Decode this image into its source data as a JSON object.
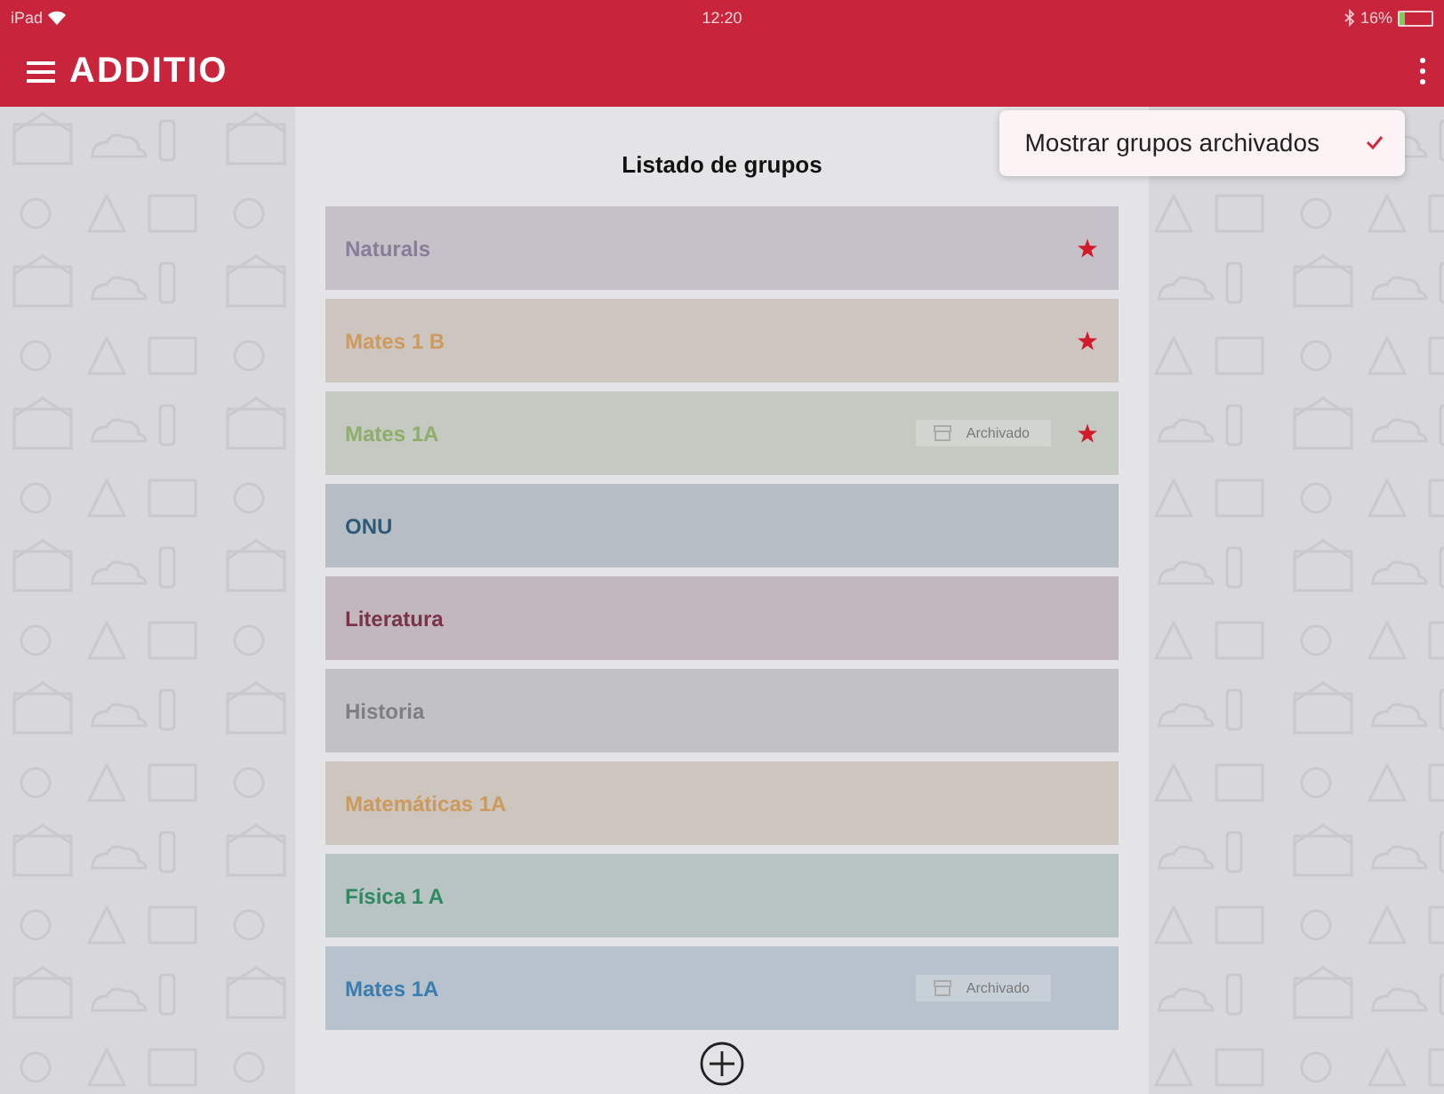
{
  "status_bar": {
    "device": "iPad",
    "time": "12:20",
    "battery": "16%"
  },
  "app_bar": {
    "title": "ADDITIO"
  },
  "menu": {
    "items": [
      {
        "label": "Mostrar grupos archivados",
        "checked": true
      }
    ]
  },
  "panel": {
    "title": "Listado de grupos",
    "groups": [
      {
        "name": "Naturals",
        "color": "#8a7d99",
        "starred": true
      },
      {
        "name": "Mates 1 B",
        "color": "#cf9a5e",
        "starred": true
      },
      {
        "name": "Mates 1A",
        "color": "#8fae6a",
        "starred": true,
        "badge": "Archivado"
      },
      {
        "name": "ONU",
        "color": "#2e5a78",
        "starred": false
      },
      {
        "name": "Literatura",
        "color": "#7a3348",
        "starred": false
      },
      {
        "name": "Historia",
        "color": "#7e7e84",
        "starred": false
      },
      {
        "name": "Matemáticas 1A",
        "color": "#cc9a5a",
        "starred": false
      },
      {
        "name": "Física 1 A",
        "color": "#2f8a64",
        "starred": false
      },
      {
        "name": "Mates 1A",
        "color": "#3a7eb0",
        "starred": false,
        "badge": "Archivado"
      }
    ]
  }
}
